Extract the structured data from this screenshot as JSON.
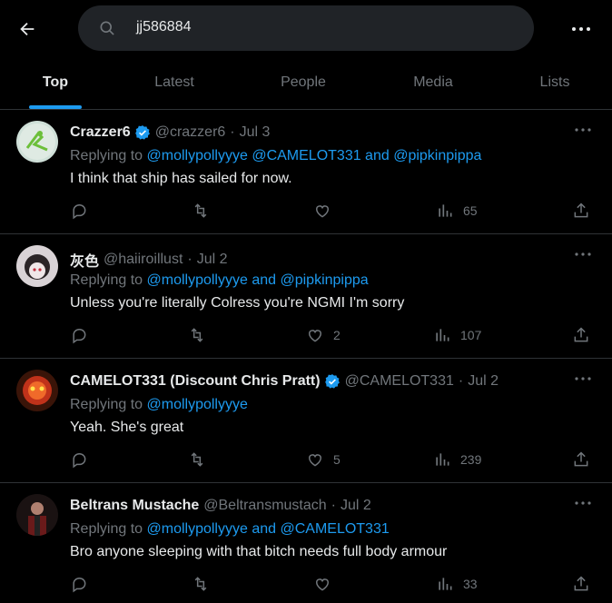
{
  "search": {
    "value": "jj586884"
  },
  "tabs": [
    {
      "label": "Top",
      "active": true
    },
    {
      "label": "Latest"
    },
    {
      "label": "People"
    },
    {
      "label": "Media"
    },
    {
      "label": "Lists"
    }
  ],
  "tweets": [
    {
      "name": "Crazzer6",
      "verified": true,
      "handle": "@crazzer6",
      "date": "Jul 3",
      "replying_prefix": "Replying to",
      "mentions": [
        "@mollypollyyye",
        "@CAMELOT331",
        "@pipkinpippa"
      ],
      "mentions_joined": "@mollypollyyye @CAMELOT331 and @pipkinpippa",
      "text": "I think that ship has sailed for now.",
      "likes": "",
      "views": "65"
    },
    {
      "name": "灰色",
      "verified": false,
      "handle": "@haiiroillust",
      "date": "Jul 2",
      "replying_prefix": "Replying to",
      "mentions_joined": "@mollypollyyye and @pipkinpippa",
      "text": "Unless you're literally Colress you're NGMI I'm sorry",
      "likes": "2",
      "views": "107"
    },
    {
      "name": "CAMELOT331 (Discount Chris Pratt)",
      "verified": true,
      "handle": "@CAMELOT331",
      "date": "Jul 2",
      "replying_prefix": "Replying to",
      "mentions_joined": "@mollypollyyye",
      "text": "Yeah. She's great",
      "likes": "5",
      "views": "239"
    },
    {
      "name": "Beltrans Mustache",
      "verified": false,
      "handle": "@Beltransmustach",
      "date": "Jul 2",
      "replying_prefix": "Replying to",
      "mentions_joined": "@mollypollyyye and @CAMELOT331",
      "text": "Bro anyone sleeping with that bitch needs full body armour",
      "likes": "",
      "views": "33"
    }
  ],
  "meta": {
    "separator": "·"
  },
  "colors": {
    "accent": "#1d9bf0",
    "muted": "#71767b",
    "text": "#e7e9ea",
    "border": "#2f3336"
  }
}
